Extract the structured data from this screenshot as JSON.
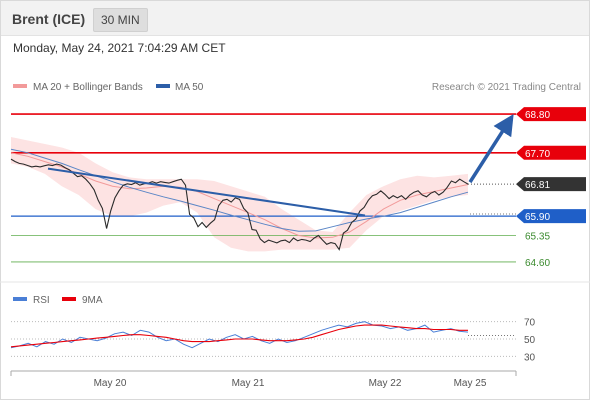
{
  "header": {
    "instrument": "Brent (ICE)",
    "timeframe": "30 MIN"
  },
  "datetime": "Monday, May 24, 2021 7:04:29 AM CET",
  "legend": {
    "ma20_bollinger": "MA 20 + Bollinger Bands",
    "ma50": "MA 50",
    "copyright": "Research © 2021 Trading Central",
    "rsi": "RSI",
    "rsi_ma": "9MA"
  },
  "colors": {
    "resistance": "#e8000b",
    "support": "#1f5fc8",
    "support_minor": "#5fae4e",
    "trendline": "#2c5ea8",
    "bollinger_fill": "#fde3e3",
    "ma20": "#f29a9a",
    "ma50": "#5b86c6",
    "price": "#2b2b2b",
    "rsi": "#4a7fd6",
    "rsi_ma": "#e8000b"
  },
  "chart_data": [
    {
      "type": "line",
      "panel": "price",
      "x_labels": [
        "May 20",
        "May 21",
        "May 22",
        "May 25"
      ],
      "ylim": [
        64.2,
        69.2
      ],
      "current_price": 66.81,
      "levels": [
        {
          "value": 68.8,
          "label": "68.80",
          "kind": "target"
        },
        {
          "value": 67.7,
          "label": "67.70",
          "kind": "resistance"
        },
        {
          "value": 65.9,
          "label": "65.90",
          "kind": "pivot"
        },
        {
          "value": 65.35,
          "label": "65.35",
          "kind": "support"
        },
        {
          "value": 64.6,
          "label": "64.60",
          "kind": "support"
        }
      ],
      "series": [
        {
          "name": "Price",
          "values": [
            67.52,
            67.45,
            67.4,
            67.38,
            67.34,
            67.3,
            67.32,
            67.3,
            67.33,
            67.36,
            67.34,
            67.38,
            67.35,
            67.28,
            67.22,
            67.12,
            67.02,
            67.05,
            66.95,
            66.82,
            66.65,
            66.35,
            66.12,
            65.55,
            66.05,
            66.42,
            66.62,
            66.78,
            66.82,
            66.8,
            66.85,
            66.78,
            66.82,
            66.84,
            66.88,
            66.84,
            66.88,
            66.86,
            66.84,
            66.88,
            66.92,
            66.95,
            66.78,
            65.95,
            65.85,
            65.6,
            65.72,
            65.58,
            65.7,
            65.8,
            66.2,
            66.35,
            66.38,
            66.3,
            66.42,
            66.38,
            66.12,
            66.0,
            65.52,
            65.5,
            65.25,
            65.15,
            65.22,
            65.18,
            65.14,
            65.2,
            65.22,
            65.15,
            65.28,
            65.2,
            65.24,
            65.22,
            65.18,
            65.28,
            65.35,
            65.22,
            65.1,
            65.15,
            65.12,
            64.95,
            65.42,
            65.5,
            65.72,
            65.82,
            66.05,
            66.15,
            66.35,
            66.48,
            66.52,
            66.62,
            66.52,
            66.4,
            66.48,
            66.42,
            66.48,
            66.38,
            66.5,
            66.58,
            66.62,
            66.5,
            66.45,
            66.55,
            66.6,
            66.5,
            66.58,
            66.72,
            66.9,
            66.85,
            66.95,
            66.88,
            66.81
          ]
        },
        {
          "name": "MA 50",
          "values": [
            67.8,
            67.7,
            67.55,
            67.4,
            67.22,
            67.05,
            66.88,
            66.72,
            66.58,
            66.45,
            66.33,
            66.2,
            66.07,
            65.93,
            65.8,
            65.67,
            65.55,
            65.47,
            65.48,
            65.6,
            65.72,
            65.82,
            65.9,
            66.0,
            66.15,
            66.3,
            66.45,
            66.58
          ]
        },
        {
          "name": "MA 20",
          "values": [
            67.7,
            67.6,
            67.45,
            67.3,
            67.1,
            66.9,
            66.75,
            66.68,
            66.7,
            66.75,
            66.72,
            66.6,
            66.4,
            66.2,
            66.0,
            65.8,
            65.55,
            65.35,
            65.28,
            65.3,
            65.45,
            65.75,
            66.1,
            66.35,
            66.5,
            66.6,
            66.7,
            66.8
          ]
        },
        {
          "name": "Bollinger Upper",
          "values": [
            68.15,
            68.05,
            67.95,
            67.85,
            67.7,
            67.4,
            67.15,
            67.0,
            66.95,
            66.95,
            66.95,
            66.95,
            66.9,
            66.75,
            66.6,
            66.45,
            66.1,
            65.8,
            65.5,
            65.45,
            66.0,
            66.5,
            66.75,
            66.95,
            67.05,
            67.0,
            67.05,
            67.1
          ]
        },
        {
          "name": "Bollinger Lower",
          "values": [
            67.4,
            67.3,
            67.1,
            66.75,
            66.5,
            66.1,
            65.9,
            65.9,
            66.0,
            66.2,
            66.3,
            66.0,
            65.3,
            65.0,
            64.9,
            64.9,
            64.95,
            64.95,
            64.95,
            64.95,
            65.0,
            65.5,
            65.9,
            66.05,
            66.2,
            66.35,
            66.45,
            66.5
          ]
        }
      ],
      "annotations": [
        {
          "type": "trendline",
          "from": [
            67.25,
            0
          ],
          "to": [
            65.92,
            0.81
          ]
        },
        {
          "type": "arrow",
          "from": [
            66.81,
            0.82
          ],
          "to": [
            68.78,
            0.92
          ],
          "direction": "up"
        }
      ]
    },
    {
      "type": "line",
      "panel": "indicator",
      "ylim": [
        20,
        80
      ],
      "y_ticks": [
        "70",
        "50",
        "30"
      ],
      "series": [
        {
          "name": "RSI",
          "values": [
            40,
            42,
            45,
            41,
            47,
            44,
            50,
            46,
            52,
            50,
            48,
            51,
            56,
            58,
            54,
            60,
            58,
            52,
            48,
            50,
            44,
            40,
            45,
            50,
            47,
            52,
            55,
            50,
            53,
            48,
            45,
            50,
            46,
            48,
            52,
            56,
            60,
            63,
            66,
            64,
            68,
            70,
            66,
            65,
            62,
            64,
            60,
            62,
            66,
            58,
            60,
            62,
            59,
            58
          ]
        },
        {
          "name": "9MA",
          "values": [
            41,
            42,
            43,
            44,
            45,
            46,
            47,
            48,
            49,
            50,
            51,
            52,
            53,
            54,
            55,
            55,
            54,
            53,
            52,
            50,
            48,
            47,
            47,
            47,
            48,
            49,
            50,
            50,
            50,
            49,
            48,
            48,
            48,
            49,
            50,
            52,
            55,
            58,
            61,
            63,
            65,
            66,
            66,
            66,
            65,
            64,
            63,
            62,
            62,
            61,
            61,
            61,
            60,
            60
          ]
        }
      ]
    }
  ]
}
